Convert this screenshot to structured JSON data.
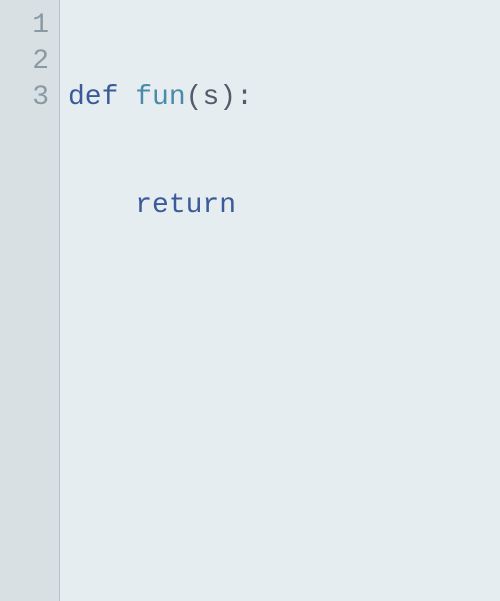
{
  "editor": {
    "lines": [
      {
        "num": "1"
      },
      {
        "num": "2"
      },
      {
        "num": "3"
      }
    ],
    "tokens": {
      "def_kw": "def",
      "fn_name": "fun",
      "lparen": "(",
      "param_s": "s",
      "rparen": ")",
      "colon": ":",
      "indent": "    ",
      "return_kw": "return"
    }
  }
}
